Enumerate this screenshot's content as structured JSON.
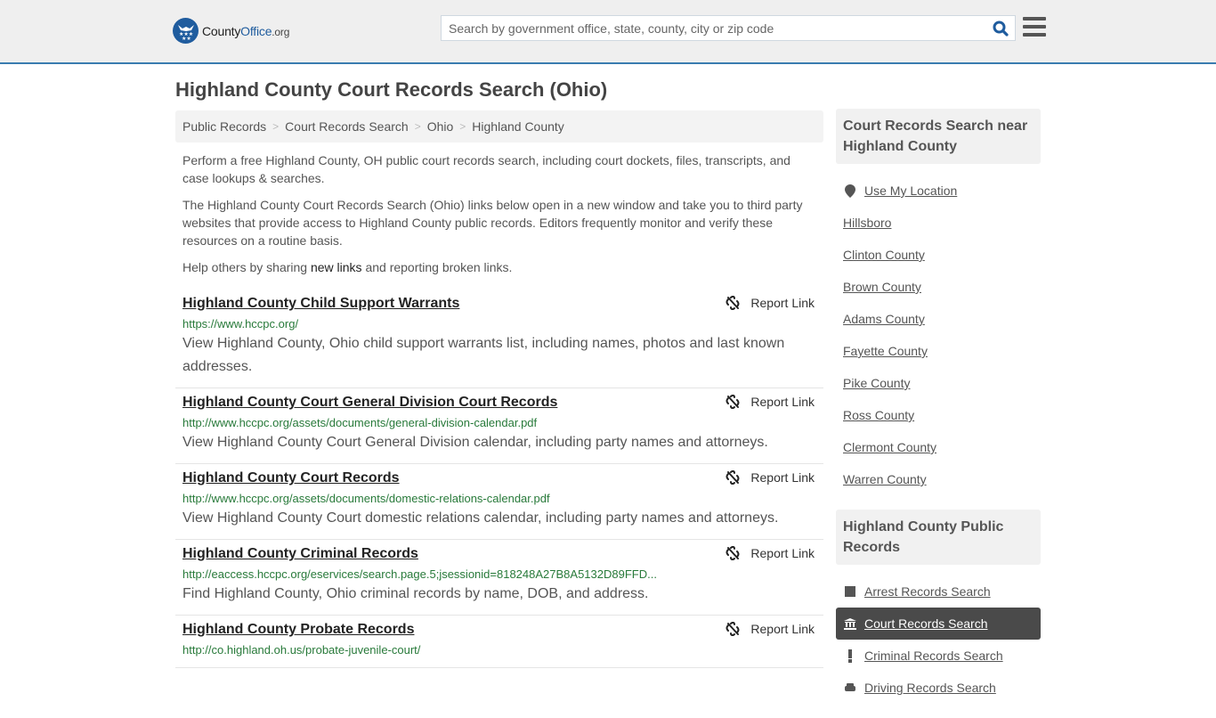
{
  "header": {
    "logo": {
      "part1": "County",
      "part2": "Office",
      "part3": ".org"
    },
    "search_placeholder": "Search by government office, state, county, city or zip code",
    "search_value": ""
  },
  "page_title": "Highland County Court Records Search (Ohio)",
  "breadcrumb": [
    "Public Records",
    "Court Records Search",
    "Ohio",
    "Highland County"
  ],
  "intro": {
    "p1": "Perform a free Highland County, OH public court records search, including court dockets, files, transcripts, and case lookups & searches.",
    "p2": "The Highland County Court Records Search (Ohio) links below open in a new window and take you to third party websites that provide access to Highland County public records. Editors frequently monitor and verify these resources on a routine basis.",
    "p3_before": "Help others by sharing ",
    "p3_link": "new links",
    "p3_after": " and reporting broken links."
  },
  "report_label": "Report Link",
  "results": [
    {
      "title": "Highland County Child Support Warrants",
      "url": "https://www.hccpc.org/",
      "desc": "View Highland County, Ohio child support warrants list, including names, photos and last known addresses."
    },
    {
      "title": "Highland County Court General Division Court Records",
      "url": "http://www.hccpc.org/assets/documents/general-division-calendar.pdf",
      "desc": "View Highland County Court General Division calendar, including party names and attorneys."
    },
    {
      "title": "Highland County Court Records",
      "url": "http://www.hccpc.org/assets/documents/domestic-relations-calendar.pdf",
      "desc": "View Highland County Court domestic relations calendar, including party names and attorneys."
    },
    {
      "title": "Highland County Criminal Records",
      "url": "http://eaccess.hccpc.org/eservices/search.page.5;jsessionid=818248A27B8A5132D89FFD...",
      "desc": "Find Highland County, Ohio criminal records by name, DOB, and address."
    },
    {
      "title": "Highland County Probate Records",
      "url": "http://co.highland.oh.us/probate-juvenile-court/",
      "desc": ""
    }
  ],
  "sidebar": {
    "nearby_title": "Court Records Search near Highland County",
    "use_location": "Use My Location",
    "nearby": [
      "Hillsboro",
      "Clinton County",
      "Brown County",
      "Adams County",
      "Fayette County",
      "Pike County",
      "Ross County",
      "Clermont County",
      "Warren County"
    ],
    "public_title": "Highland County Public Records",
    "public": [
      {
        "label": "Arrest Records Search",
        "icon": "square-icon",
        "active": false
      },
      {
        "label": "Court Records Search",
        "icon": "courthouse-icon",
        "active": true
      },
      {
        "label": "Criminal Records Search",
        "icon": "exclamation-icon",
        "active": false
      },
      {
        "label": "Driving Records Search",
        "icon": "car-icon",
        "active": false
      }
    ]
  },
  "colors": {
    "brand_blue": "#1f5c9e",
    "header_border": "#3a7cb0",
    "url_green": "#287a3a",
    "active_bg": "#4a4a4a"
  }
}
